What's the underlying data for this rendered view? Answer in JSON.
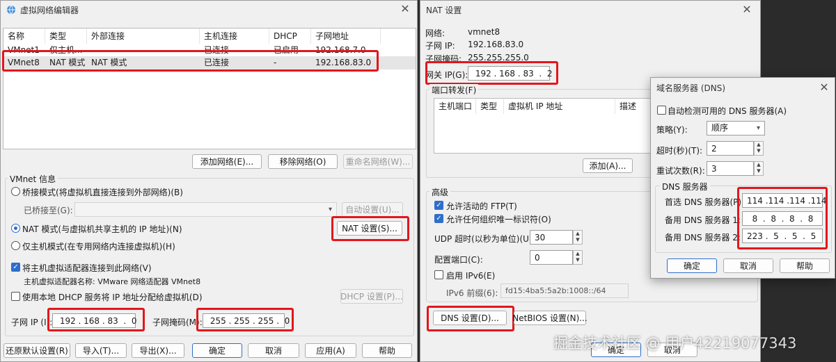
{
  "vne": {
    "title": "虚拟网络编辑器",
    "headers": [
      "名称",
      "类型",
      "外部连接",
      "主机连接",
      "DHCP",
      "子网地址"
    ],
    "rows": [
      {
        "name": "VMnet1",
        "type": "仅主机...",
        "ext": "-",
        "host": "已连接",
        "dhcp": "已启用",
        "subnet": "192.168.7.0"
      },
      {
        "name": "VMnet8",
        "type": "NAT 模式",
        "ext": "NAT 模式",
        "host": "已连接",
        "dhcp": "-",
        "subnet": "192.168.83.0"
      }
    ],
    "add_network": "添加网络(E)...",
    "remove_network": "移除网络(O)",
    "rename_network": "重命名网络(W)...",
    "vmnet_info": "VMnet 信息",
    "bridge_mode": "桥接模式(将虚拟机直接连接到外部网络)(B)",
    "bridged_to": "已桥接至(G):",
    "auto_settings": "自动设置(U)...",
    "nat_mode": "NAT 模式(与虚拟机共享主机的 IP 地址)(N)",
    "nat_settings": "NAT 设置(S)...",
    "host_only": "仅主机模式(在专用网络内连接虚拟机)(H)",
    "connect_adapter": "将主机虚拟适配器连接到此网络(V)",
    "adapter_name": "主机虚拟适配器名称: VMware 网络适配器 VMnet8",
    "use_dhcp": "使用本地 DHCP 服务将 IP 地址分配给虚拟机(D)",
    "dhcp_settings": "DHCP 设置(P)...",
    "subnet_ip_label": "子网 IP (I):",
    "subnet_ip": " 192 . 168 . 83  .  0",
    "subnet_mask_label": "子网掩码(M):",
    "subnet_mask": " 255 . 255 . 255 .  0",
    "restore": "还原默认设置(R)",
    "import": "导入(T)...",
    "export": "导出(X)...",
    "ok": "确定",
    "cancel": "取消",
    "apply": "应用(A)",
    "help": "帮助"
  },
  "nat": {
    "title": "NAT 设置",
    "network_label": "网络:",
    "network_value": "vmnet8",
    "subnet_ip_label": "子网 IP:",
    "subnet_ip_value": "192.168.83.0",
    "subnet_mask_label": "子网掩码:",
    "subnet_mask_value": "255.255.255.0",
    "gateway_label": "网关 IP(G):",
    "gateway_value": " 192 . 168 . 83  .  2",
    "port_forward": "端口转发(F)",
    "pf_headers": [
      "主机端口",
      "类型",
      "虚拟机 IP 地址",
      "描述"
    ],
    "add": "添加(A)...",
    "advanced": "高级",
    "allow_ftp": "允许活动的 FTP(T)",
    "allow_oui": "允许任何组织唯一标识符(O)",
    "udp_timeout_label": "UDP 超时(以秒为单位)(U):",
    "udp_timeout": "30",
    "config_port_label": "配置端口(C):",
    "config_port": "0",
    "enable_ipv6": "启用 IPv6(E)",
    "ipv6_prefix_label": "IPv6 前缀(6):",
    "ipv6_prefix": "fd15:4ba5:5a2b:1008::/64",
    "dns_settings": "DNS 设置(D)...",
    "netbios_settings": "NetBIOS 设置(N)...",
    "ok": "确定",
    "cancel": "取消"
  },
  "dns": {
    "title": "域名服务器 (DNS)",
    "auto_detect": "自动检测可用的 DNS 服务器(A)",
    "policy_label": "策略(Y):",
    "policy_value": "顺序",
    "timeout_label": "超时(秒)(T):",
    "timeout_value": "2",
    "retries_label": "重试次数(R):",
    "retries_value": "3",
    "servers_group": "DNS 服务器",
    "preferred_label": "首选 DNS 服务器(P):",
    "preferred_value": "114 .114 .114 .114",
    "alt1_label": "备用 DNS 服务器 1:",
    "alt1_value": "  8  .  8  .  8  .  8",
    "alt2_label": "备用 DNS 服务器 2:",
    "alt2_value": "223 .  5  .  5  .  5",
    "ok": "确定",
    "cancel": "取消",
    "help": "帮助"
  },
  "watermark": "掘金技术社区 @ 用户4221907734​3"
}
